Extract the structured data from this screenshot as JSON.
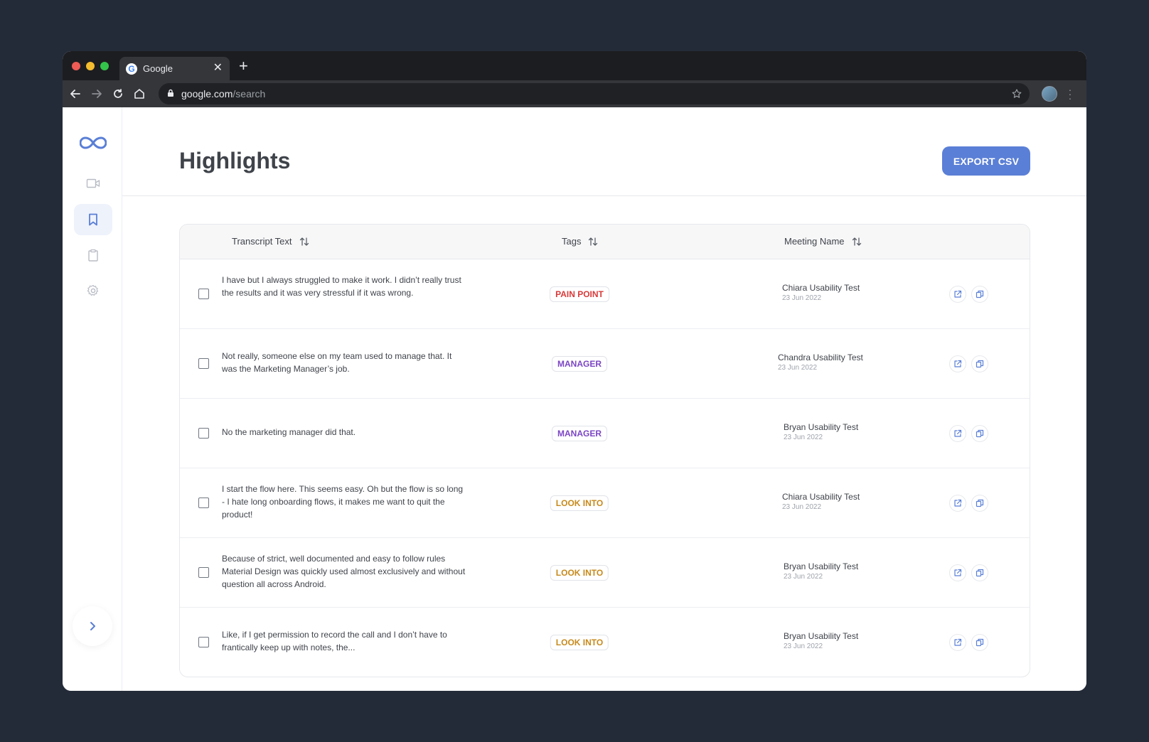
{
  "browser": {
    "tab_title": "Google",
    "tab_close": "✕",
    "new_tab": "+",
    "url_host": "google.com",
    "url_path": "/search"
  },
  "page": {
    "title": "Highlights",
    "export_label": "EXPORT CSV"
  },
  "table": {
    "headers": {
      "transcript": "Transcript Text",
      "tags": "Tags",
      "meeting": "Meeting Name"
    },
    "rows": [
      {
        "text": "I have but I always struggled to make it work. I didn’t really trust the results and it was very stressful if it was wrong.",
        "tag": "PAIN POINT",
        "tag_color": "#d93a3a",
        "meeting": "Chiara Usability Test",
        "date": "23 Jun 2022"
      },
      {
        "text": "Not really, someone else on my team used to manage that. It was the Marketing Manager’s job.",
        "tag": "MANAGER",
        "tag_color": "#7b45c4",
        "meeting": "Chandra Usability Test",
        "date": "23 Jun 2022"
      },
      {
        "text": "No the marketing manager did that.",
        "tag": "MANAGER",
        "tag_color": "#7b45c4",
        "meeting": "Bryan Usability Test",
        "date": "23 Jun 2022"
      },
      {
        "text": "I start the flow here. This seems easy. Oh but the flow is so long - I hate long onboarding flows, it makes me want to quit the product!",
        "tag": "LOOK INTO",
        "tag_color": "#c78a1c",
        "meeting": "Chiara Usability Test",
        "date": "23 Jun 2022"
      },
      {
        "text": "Because of strict, well documented and easy to follow rules Material Design was quickly used almost exclusively and without question all across Android.",
        "tag": "LOOK INTO",
        "tag_color": "#c78a1c",
        "meeting": "Bryan Usability Test",
        "date": "23 Jun 2022"
      },
      {
        "text": "Like, if I get permission to record the call and I don’t have to frantically keep up with notes, the...",
        "tag": "LOOK INTO",
        "tag_color": "#c78a1c",
        "meeting": "Bryan Usability Test",
        "date": "23 Jun 2022"
      }
    ]
  },
  "colors": {
    "accent": "#5a7fd6",
    "background": "#242b38"
  },
  "icons": {
    "logo": "infinity-logo-icon",
    "sidebar": [
      "video-camera-icon",
      "bookmark-icon",
      "clipboard-icon",
      "settings-gear-icon"
    ],
    "row_actions": [
      "external-link-icon",
      "copy-icon"
    ]
  }
}
